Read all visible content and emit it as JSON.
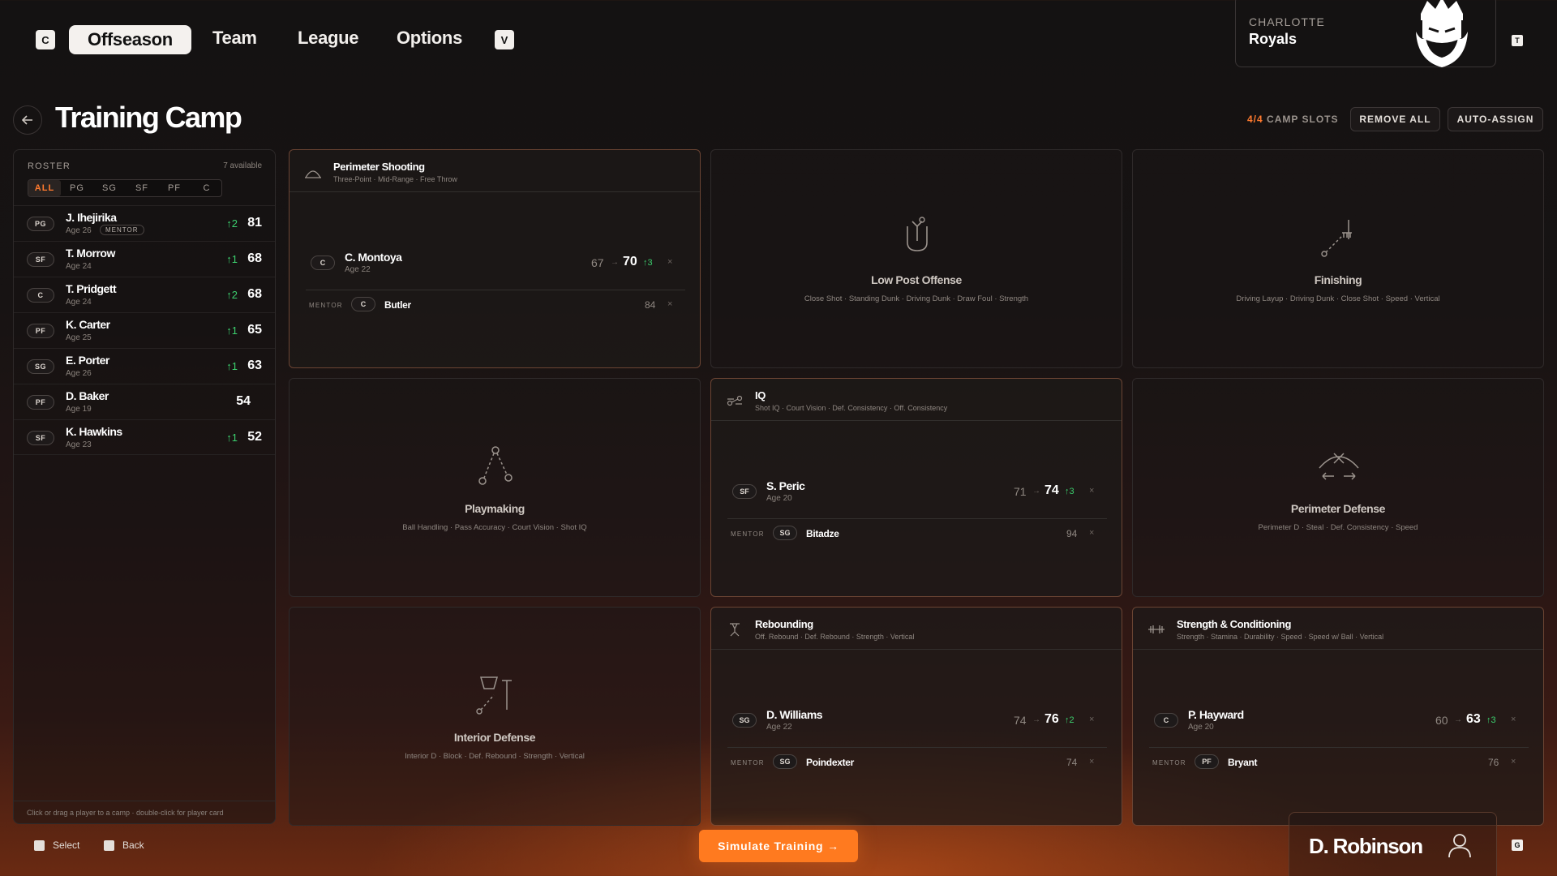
{
  "nav": {
    "left_key": "C",
    "right_key": "V",
    "tabs": [
      {
        "label": "Offseason",
        "active": true
      },
      {
        "label": "Team"
      },
      {
        "label": "League"
      },
      {
        "label": "Options"
      }
    ]
  },
  "team": {
    "city": "CHARLOTTE",
    "name": "Royals",
    "key": "T",
    "logo_icon": "crowned-king-logo"
  },
  "page": {
    "title": "Training Camp",
    "slots_used": "4/4",
    "slots_label": "CAMP SLOTS",
    "remove_all": "REMOVE ALL",
    "auto_assign": "AUTO-ASSIGN"
  },
  "roster": {
    "label": "ROSTER",
    "available": "7 available",
    "filters": [
      "ALL",
      "PG",
      "SG",
      "SF",
      "PF",
      "C"
    ],
    "players": [
      {
        "pos": "PG",
        "name": "J. Ihejirika",
        "age": "Age 26",
        "tag": "MENTOR",
        "delta": "↑2",
        "ovr": "81"
      },
      {
        "pos": "SF",
        "name": "T. Morrow",
        "age": "Age 24",
        "delta": "↑1",
        "ovr": "68"
      },
      {
        "pos": "C",
        "name": "T. Pridgett",
        "age": "Age 24",
        "delta": "↑2",
        "ovr": "68"
      },
      {
        "pos": "PF",
        "name": "K. Carter",
        "age": "Age 25",
        "delta": "↑1",
        "ovr": "65"
      },
      {
        "pos": "SG",
        "name": "E. Porter",
        "age": "Age 26",
        "delta": "↑1",
        "ovr": "63"
      },
      {
        "pos": "PF",
        "name": "D. Baker",
        "age": "Age 19",
        "delta": "",
        "ovr": "54"
      },
      {
        "pos": "SF",
        "name": "K. Hawkins",
        "age": "Age 23",
        "delta": "↑1",
        "ovr": "52"
      }
    ],
    "footer": "Click or drag a player to a camp · double-click for player card"
  },
  "camps": {
    "perimeter_shooting": {
      "title": "Perimeter Shooting",
      "sub": "Three-Point · Mid-Range · Free Throw",
      "player": {
        "pos": "C",
        "name": "C. Montoya",
        "age": "Age 22",
        "from": "67",
        "to": "70",
        "gain": "↑3"
      },
      "mentor": {
        "label": "MENTOR",
        "pos": "C",
        "name": "Butler",
        "ovr": "84"
      }
    },
    "low_post": {
      "title": "Low Post Offense",
      "sub": "Close Shot · Standing Dunk · Driving Dunk · Draw Foul · Strength"
    },
    "finishing": {
      "title": "Finishing",
      "sub": "Driving Layup · Driving Dunk · Close Shot · Speed · Vertical"
    },
    "playmaking": {
      "title": "Playmaking",
      "sub": "Ball Handling · Pass Accuracy · Court Vision · Shot IQ"
    },
    "iq": {
      "title": "IQ",
      "sub": "Shot IQ · Court Vision · Def. Consistency · Off. Consistency",
      "player": {
        "pos": "SF",
        "name": "S. Peric",
        "age": "Age 20",
        "from": "71",
        "to": "74",
        "gain": "↑3"
      },
      "mentor": {
        "label": "MENTOR",
        "pos": "SG",
        "name": "Bitadze",
        "ovr": "94"
      }
    },
    "perimeter_defense": {
      "title": "Perimeter Defense",
      "sub": "Perimeter D · Steal · Def. Consistency · Speed"
    },
    "interior_defense": {
      "title": "Interior Defense",
      "sub": "Interior D · Block · Def. Rebound · Strength · Vertical"
    },
    "rebounding": {
      "title": "Rebounding",
      "sub": "Off. Rebound · Def. Rebound · Strength · Vertical",
      "player": {
        "pos": "SG",
        "name": "D. Williams",
        "age": "Age 22",
        "from": "74",
        "to": "76",
        "gain": "↑2"
      },
      "mentor": {
        "label": "MENTOR",
        "pos": "SG",
        "name": "Poindexter",
        "ovr": "74"
      }
    },
    "strength": {
      "title": "Strength & Conditioning",
      "sub": "Strength · Stamina · Durability · Speed · Speed w/ Ball · Vertical",
      "player": {
        "pos": "C",
        "name": "P. Hayward",
        "age": "Age 20",
        "from": "60",
        "to": "63",
        "gain": "↑3"
      },
      "mentor": {
        "label": "MENTOR",
        "pos": "PF",
        "name": "Bryant",
        "ovr": "76"
      }
    }
  },
  "footer": {
    "select": "Select",
    "back": "Back",
    "simulate": "Simulate Training →",
    "user": "D. Robinson",
    "user_key": "G"
  },
  "colors": {
    "accent": "#ff7a1f",
    "gain": "#3ccf6e"
  }
}
